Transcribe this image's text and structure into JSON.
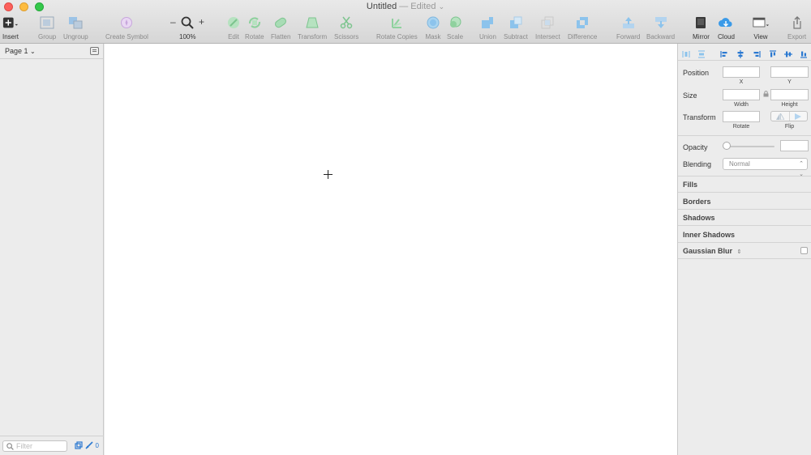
{
  "window": {
    "title": "Untitled",
    "status": "— Edited",
    "status_chevron": "⌄"
  },
  "toolbar": {
    "zoom_minus": "–",
    "zoom_plus": "+",
    "items": [
      {
        "label": "Insert",
        "icon": "insert-icon"
      },
      {
        "label": "Group",
        "icon": "group-icon"
      },
      {
        "label": "Ungroup",
        "icon": "ungroup-icon"
      },
      {
        "label": "Create Symbol",
        "icon": "symbol-icon"
      },
      {
        "label": "100%",
        "icon": "zoom-icon"
      },
      {
        "label": "Edit",
        "icon": "edit-icon"
      },
      {
        "label": "Rotate",
        "icon": "rotate-icon"
      },
      {
        "label": "Flatten",
        "icon": "flatten-icon"
      },
      {
        "label": "Transform",
        "icon": "transform-icon"
      },
      {
        "label": "Scissors",
        "icon": "scissors-icon"
      },
      {
        "label": "Rotate Copies",
        "icon": "rotate-copies-icon"
      },
      {
        "label": "Mask",
        "icon": "mask-icon"
      },
      {
        "label": "Scale",
        "icon": "scale-icon"
      },
      {
        "label": "Union",
        "icon": "union-icon"
      },
      {
        "label": "Subtract",
        "icon": "subtract-icon"
      },
      {
        "label": "Intersect",
        "icon": "intersect-icon"
      },
      {
        "label": "Difference",
        "icon": "difference-icon"
      },
      {
        "label": "Forward",
        "icon": "forward-icon"
      },
      {
        "label": "Backward",
        "icon": "backward-icon"
      },
      {
        "label": "Mirror",
        "icon": "mirror-icon"
      },
      {
        "label": "Cloud",
        "icon": "cloud-icon"
      },
      {
        "label": "View",
        "icon": "view-icon"
      },
      {
        "label": "Export",
        "icon": "export-icon"
      }
    ]
  },
  "left_panel": {
    "page_label": "Page 1",
    "page_chevron": "⌄",
    "filter_placeholder": "Filter",
    "count": "0"
  },
  "inspector": {
    "position_label": "Position",
    "x_label": "X",
    "y_label": "Y",
    "size_label": "Size",
    "width_label": "Width",
    "height_label": "Height",
    "transform_label": "Transform",
    "rotate_label": "Rotate",
    "flip_label": "Flip",
    "opacity_label": "Opacity",
    "blending_label": "Blending",
    "blending_value": "Normal",
    "sections": [
      "Fills",
      "Borders",
      "Shadows",
      "Inner Shadows",
      "Gaussian Blur"
    ]
  },
  "colors": {
    "accent_blue": "#2b79d1",
    "disabled_green": "#8fd19e",
    "disabled_blue": "#8cc3ec"
  }
}
